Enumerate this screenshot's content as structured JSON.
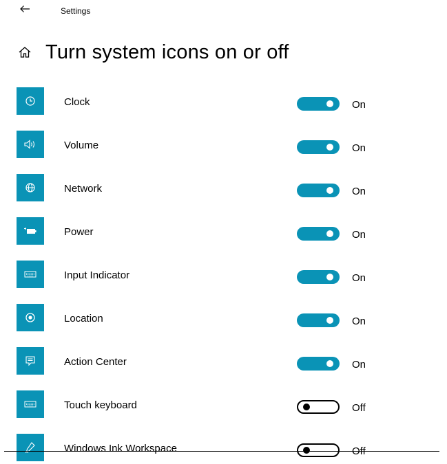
{
  "window": {
    "title": "Settings"
  },
  "page": {
    "title": "Turn system icons on or off"
  },
  "colors": {
    "accent": "#0a93b6",
    "toggle_off_border": "#000000",
    "background": "#ffffff"
  },
  "items": [
    {
      "label": "Clock",
      "icon": "clock-icon",
      "state": "On"
    },
    {
      "label": "Volume",
      "icon": "volume-icon",
      "state": "On"
    },
    {
      "label": "Network",
      "icon": "network-globe-icon",
      "state": "On"
    },
    {
      "label": "Power",
      "icon": "power-battery-icon",
      "state": "On"
    },
    {
      "label": "Input Indicator",
      "icon": "keyboard-icon",
      "state": "On"
    },
    {
      "label": "Location",
      "icon": "location-icon",
      "state": "On"
    },
    {
      "label": "Action Center",
      "icon": "action-center-icon",
      "state": "On"
    },
    {
      "label": "Touch keyboard",
      "icon": "keyboard-icon",
      "state": "Off"
    },
    {
      "label": "Windows Ink Workspace",
      "icon": "pen-icon",
      "state": "Off"
    }
  ]
}
